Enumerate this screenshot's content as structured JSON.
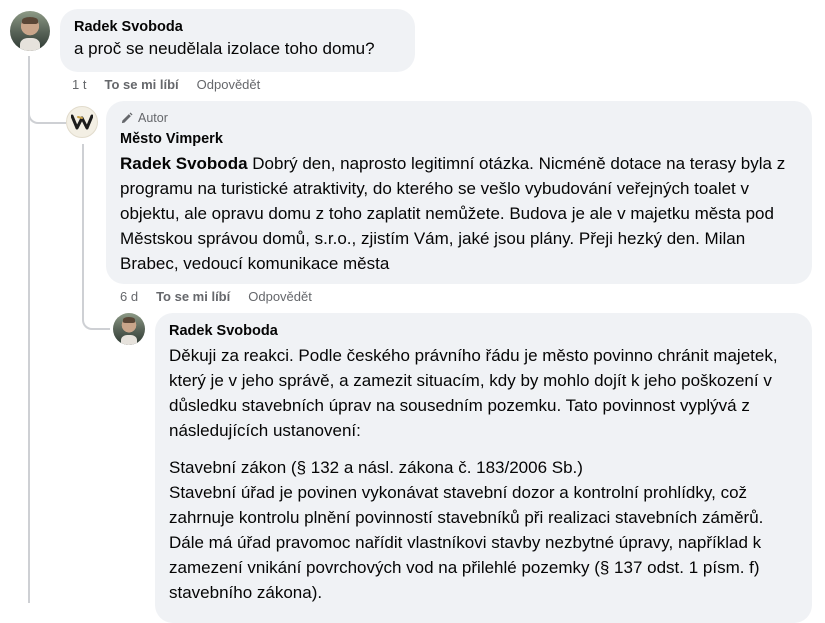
{
  "comments": [
    {
      "author": "Radek Svoboda",
      "text": "a proč se neudělala izolace toho domu?",
      "time": "1 t",
      "like": "To se mi líbí",
      "reply": "Odpovědět"
    },
    {
      "badge": "Autor",
      "author": "Město Vimperk",
      "mention": "Radek Svoboda",
      "text": " Dobrý den, naprosto legitimní otázka. Nicméně dotace na terasy byla z programu na turistické atraktivity, do kterého se vešlo vybudování veřejných toalet v objektu, ale opravu domu z toho zaplatit nemůžete. Budova je ale v majetku města pod Městskou správou domů, s.r.o., zjistím Vám, jaké jsou plány. Přeji hezký den. Milan Brabec, vedoucí komunikace města",
      "time": "6 d",
      "like": "To se mi líbí",
      "reply": "Odpovědět",
      "logo_letter": "W"
    },
    {
      "author": "Radek Svoboda",
      "para1": "Děkuji za reakci. Podle českého právního řádu je město povinno chránit majetek, který je v jeho správě, a zamezit situacím, kdy by mohlo dojít k jeho poškození v důsledku stavebních úprav na sousedním pozemku. Tato povinnost vyplývá z následujících ustanovení:",
      "para2_title": "Stavební zákon (§ 132 a násl. zákona č. 183/2006 Sb.)",
      "para2_body": "Stavební úřad je povinen vykonávat stavební dozor a kontrolní prohlídky, což zahrnuje kontrolu plnění povinností stavebníků při realizaci stavebních záměrů. Dále má úřad pravomoc nařídit vlastníkovi stavby nezbytné úpravy, například k zamezení vnikání povrchových vod na přilehlé pozemky (§ 137 odst. 1 písm. f) stavebního zákona)."
    }
  ],
  "colors": {
    "bubble": "#f0f2f5",
    "meta": "#65676b",
    "line": "#ced0d4"
  }
}
